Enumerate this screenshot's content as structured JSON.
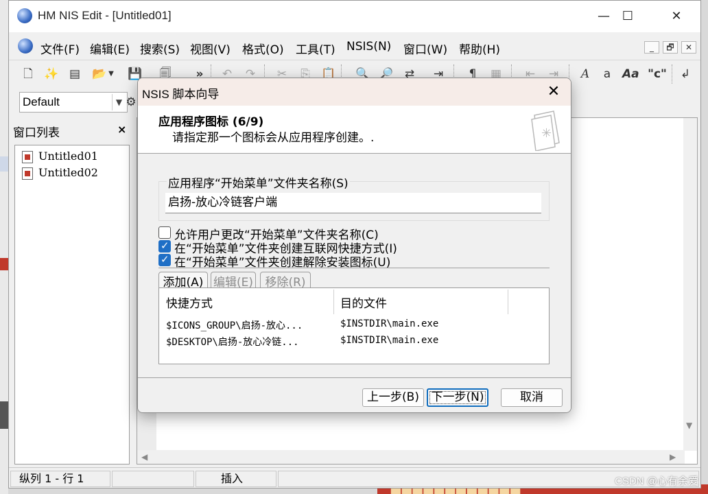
{
  "app": {
    "title": "HM NIS Edit - [Untitled01]",
    "controls": {
      "minimize": "—",
      "maximize": "☐",
      "close": "✕"
    }
  },
  "menu": {
    "items": [
      "文件(F)",
      "编辑(E)",
      "搜索(S)",
      "视图(V)",
      "格式(O)",
      "工具(T)",
      "NSIS(N)",
      "窗口(W)",
      "帮助(H)"
    ],
    "mdi": {
      "minimize": "_",
      "restore": "🗗",
      "close": "✕"
    }
  },
  "toolbar": {
    "icons": [
      "new-file-icon",
      "wizard-icon",
      "template-icon",
      "open-folder-icon",
      "dropdown-icon",
      "save-icon",
      "save-all-icon",
      "more-icon",
      "undo-icon",
      "redo-icon",
      "cut-icon",
      "copy-icon",
      "paste-icon",
      "find-icon",
      "find-next-icon",
      "replace-icon",
      "goto-icon",
      "paragraph-icon",
      "format-icon",
      "indent-icon",
      "outdent-icon",
      "font-icon",
      "lowercase-icon",
      "case-toggle-icon",
      "quote-icon",
      "wrap-icon"
    ]
  },
  "format_bar": {
    "style_value": "Default"
  },
  "panel": {
    "title": "窗口列表",
    "close": "×",
    "documents": [
      "Untitled01",
      "Untitled02"
    ]
  },
  "status": {
    "position": "纵列 1 - 行 1",
    "mode": "插入"
  },
  "dialog": {
    "title": "NSIS 脚本向导",
    "close": "✕",
    "header_title": "应用程序图标 (6/9)",
    "header_subtitle": "请指定那一个图标会从应用程序创建。.",
    "group_label": "应用程序“开始菜单”文件夹名称(S)",
    "folder_name": "启扬-放心冷链客户端",
    "options": [
      {
        "label": "允许用户更改“开始菜单”文件夹名称(C)",
        "checked": false
      },
      {
        "label": "在“开始菜单”文件夹创建互联网快捷方式(I)",
        "checked": true
      },
      {
        "label": "在“开始菜单”文件夹创建解除安装图标(U)",
        "checked": true
      }
    ],
    "tabs": [
      "添加(A)",
      "编辑(E)",
      "移除(R)"
    ],
    "table": {
      "columns": [
        "快捷方式",
        "目的文件"
      ],
      "rows": [
        [
          "$ICONS_GROUP\\启扬-放心...",
          "$INSTDIR\\main.exe"
        ],
        [
          "$DESKTOP\\启扬-放心冷链...",
          "$INSTDIR\\main.exe"
        ]
      ]
    },
    "buttons": {
      "back": "上一步(B)",
      "next": "下一步(N)",
      "cancel": "取消"
    }
  },
  "watermark": "CSDN @心有余爱",
  "colors": {
    "accent": "#0f6cbd",
    "checkbox": "#1f6fc6",
    "dialog_titlebar": "#f6ece8"
  }
}
